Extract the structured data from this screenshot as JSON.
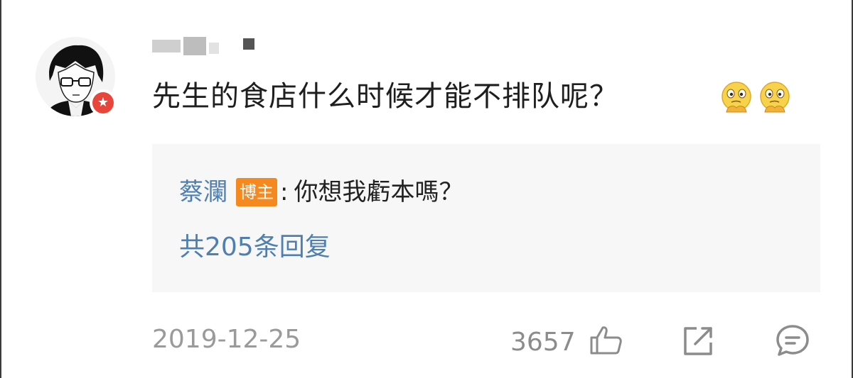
{
  "comment": {
    "text": "先生的食店什么时候才能不排队呢？",
    "emoji": [
      "thinking-emoji",
      "thinking-emoji"
    ],
    "avatar_badge_icon": "vip-star-icon",
    "badge_glyph": "★"
  },
  "reply": {
    "author": "蔡瀾",
    "author_badge": "博主",
    "colon": ":",
    "content": "你想我虧本嗎？",
    "more": "共205条回复"
  },
  "footer": {
    "date": "2019-12-25",
    "likes": "3657"
  },
  "colors": {
    "link": "#4f7fb0",
    "badge": "#f5891f",
    "muted": "#9a9a9a",
    "vip": "#e8463b",
    "reply_bg": "#f7f7f7"
  }
}
